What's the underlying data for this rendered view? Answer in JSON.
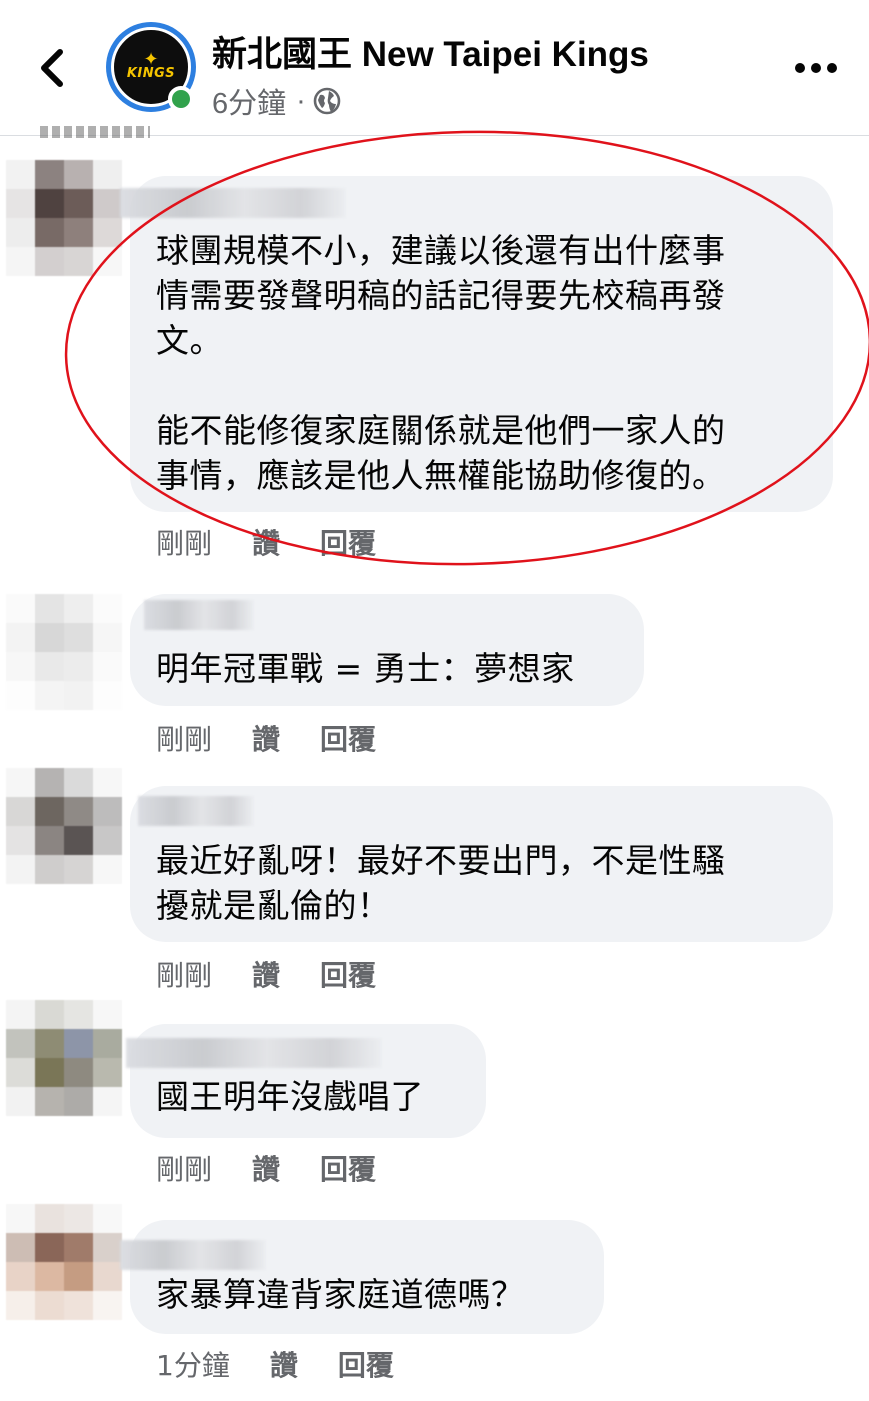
{
  "header": {
    "page_name": "新北國王 New Taipei Kings",
    "post_time": "6分鐘",
    "meta_separator": "·",
    "logo_text": "KINGS",
    "back_icon": "chevron-left-icon",
    "more_icon": "more-horizontal-icon",
    "privacy_icon": "globe-icon",
    "online_status_color": "#31a24c"
  },
  "comments": [
    {
      "text": "球團規模不小，建議以後還有出什麼事\n情需要發聲明稿的話記得要先校稿再發\n文。\n\n能不能修復家庭關係就是他們一家人的\n事情，應該是他人無權能協助修復的。",
      "time": "剛剛",
      "like": "讚",
      "reply": "回覆",
      "highlighted": true
    },
    {
      "text": "明年冠軍戰 = 勇士：夢想家",
      "time": "剛剛",
      "like": "讚",
      "reply": "回覆"
    },
    {
      "text": "最近好亂呀！最好不要出門，不是性騷\n擾就是亂倫的！",
      "time": "剛剛",
      "like": "讚",
      "reply": "回覆"
    },
    {
      "text": "國王明年沒戲唱了",
      "time": "剛剛",
      "like": "讚",
      "reply": "回覆"
    },
    {
      "text": "家暴算違背家庭道德嗎？",
      "time": "1分鐘",
      "like": "讚",
      "reply": "回覆"
    }
  ],
  "colors": {
    "bubble": "#f0f2f5",
    "meta_text": "#65676b",
    "highlight": "#e0121b",
    "avatar_ring": "#2d7fe0",
    "logo": "#f5c400"
  }
}
